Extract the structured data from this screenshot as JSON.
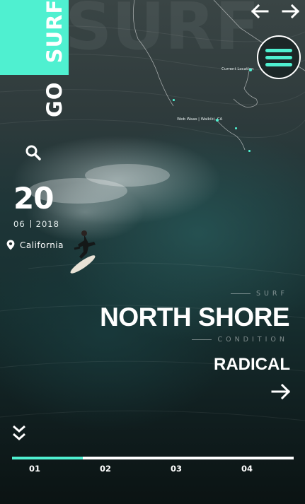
{
  "brand": {
    "line1": "GO",
    "line2": "SURF",
    "ghost_text": "SURF"
  },
  "map": {
    "current_label": "Current Location",
    "spot_label": "Web Waas | Waikiki, CA"
  },
  "date": {
    "day": "20",
    "month": "06",
    "year": "2018"
  },
  "location": {
    "name": "California"
  },
  "info": {
    "category_label": "SURF",
    "spot_name": "NORTH SHORE",
    "condition_label": "CONDITION",
    "condition_value": "RADICAL"
  },
  "pager": {
    "steps": [
      "01",
      "02",
      "03",
      "04"
    ],
    "progress_fraction": 0.25
  },
  "colors": {
    "accent": "#4ff0d0",
    "text": "#ffffff"
  },
  "icons": [
    "arrow-left-icon",
    "arrow-right-icon",
    "menu-icon",
    "search-icon",
    "location-pin-icon",
    "arrow-right-icon",
    "double-chevron-down-icon"
  ]
}
